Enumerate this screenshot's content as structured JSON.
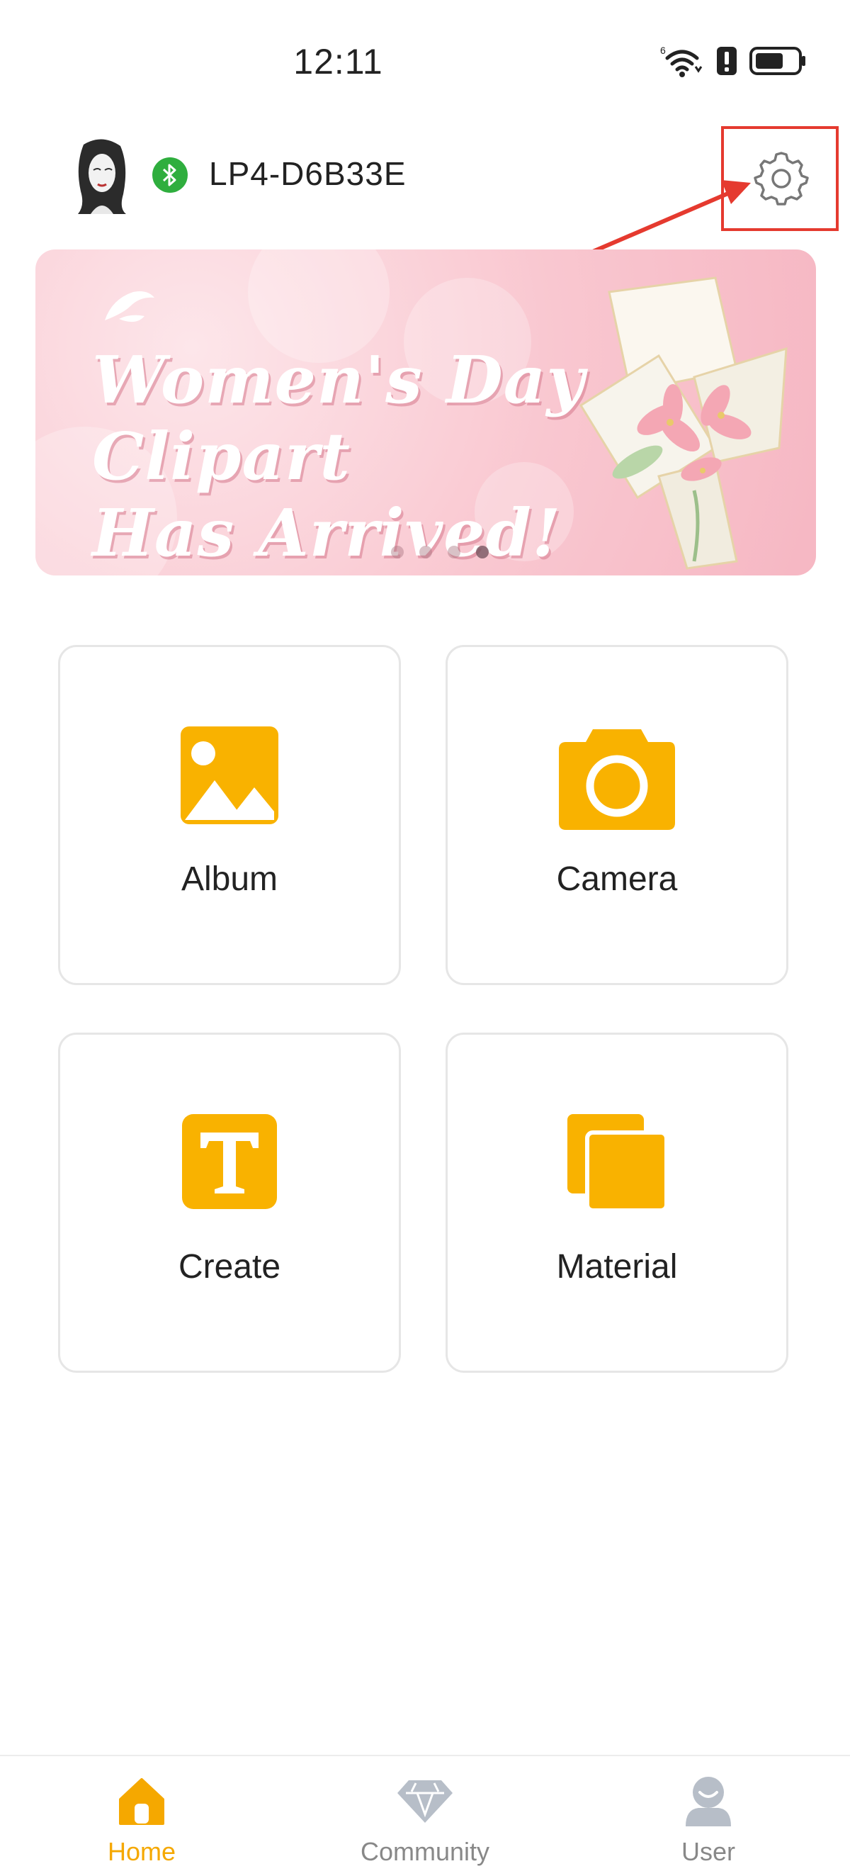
{
  "status_bar": {
    "time": "12:11",
    "network": "6"
  },
  "header": {
    "device_name": "LP4-D6B33E"
  },
  "banner": {
    "title_line1": "Women's Day Clipart",
    "title_line2": "Has Arrived!",
    "dot_count": 4,
    "active_dot": 4
  },
  "tiles": [
    {
      "label": "Album",
      "icon": "album-icon"
    },
    {
      "label": "Camera",
      "icon": "camera-icon"
    },
    {
      "label": "Create",
      "icon": "text-create-icon"
    },
    {
      "label": "Material",
      "icon": "material-copy-icon"
    }
  ],
  "bottom_nav": {
    "items": [
      {
        "label": "Home",
        "icon": "home-icon",
        "active": true
      },
      {
        "label": "Community",
        "icon": "diamond-icon",
        "active": false
      },
      {
        "label": "User",
        "icon": "user-icon",
        "active": false
      }
    ]
  },
  "colors": {
    "accent": "#F9B200",
    "bluetooth": "#2FAE3E",
    "annotation": "#E53A2F",
    "banner": "#F8C4CE"
  }
}
